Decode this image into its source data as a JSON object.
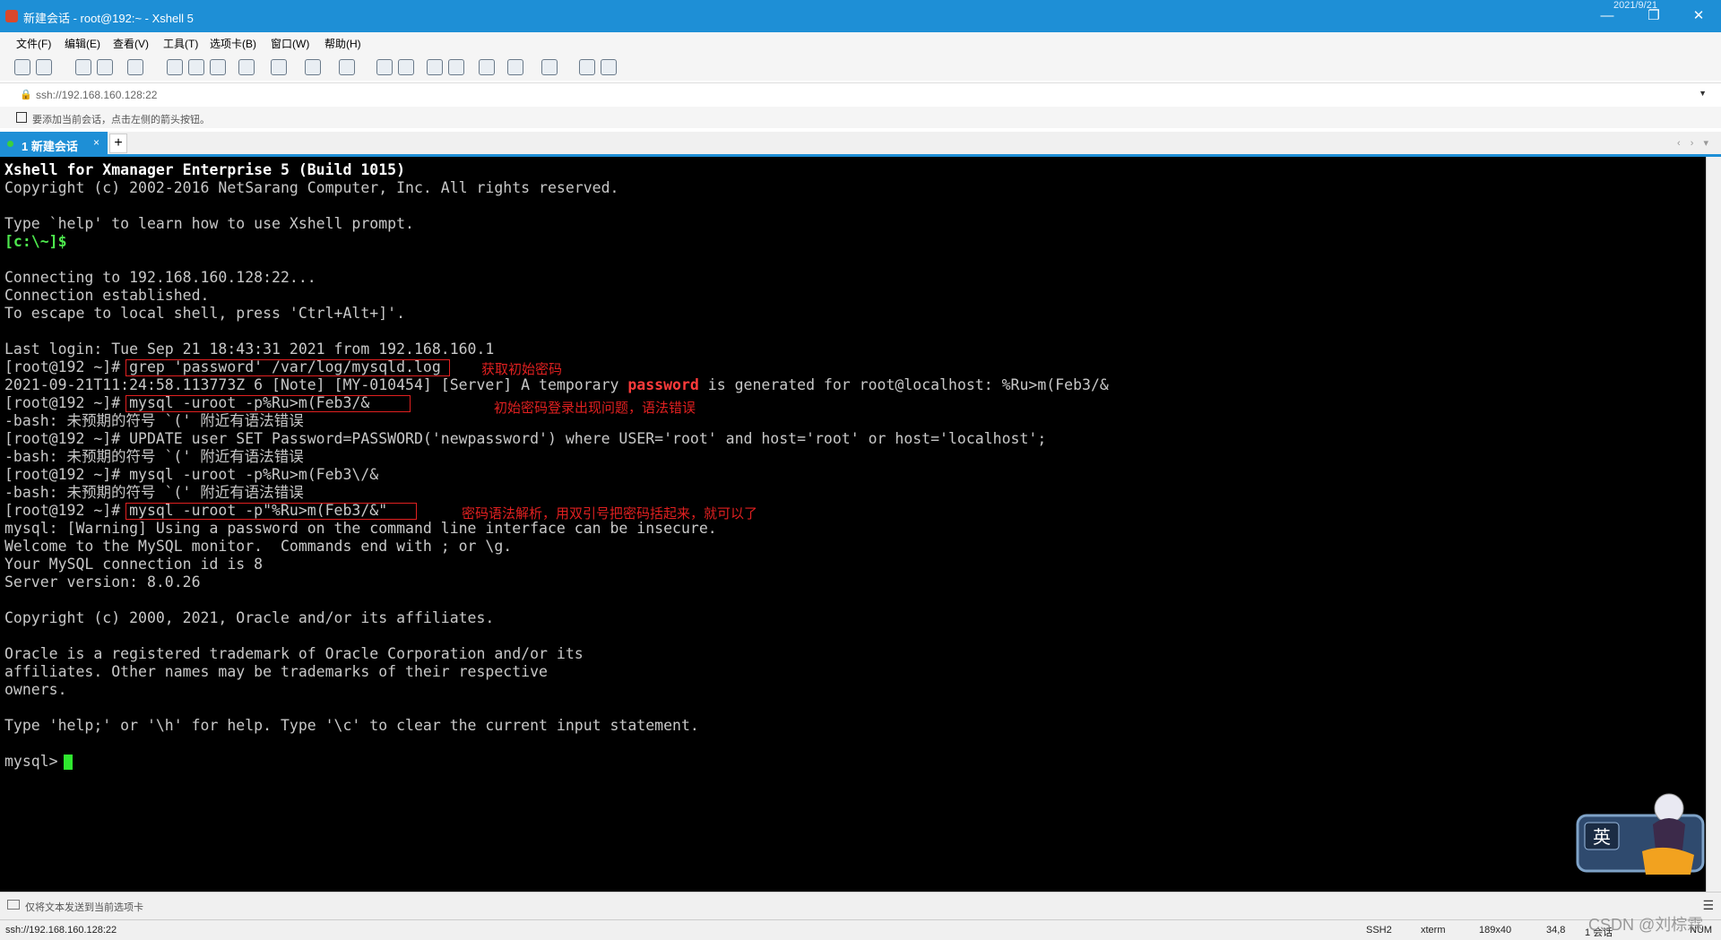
{
  "window": {
    "title": "新建会话 - root@192:~ - Xshell 5",
    "date_clip": "2021/9/21",
    "controls": {
      "minimize": "—",
      "restore": "❐",
      "close": "✕"
    }
  },
  "menu": [
    "文件(F)",
    "编辑(E)",
    "查看(V)",
    "工具(T)",
    "选项卡(B)",
    "窗口(W)",
    "帮助(H)"
  ],
  "address": {
    "url": "ssh://192.168.160.128:22"
  },
  "hint": {
    "text": "要添加当前会话，点击左侧的箭头按钮。"
  },
  "tabs": {
    "active_label": "1 新建会话",
    "close": "×",
    "add": "+",
    "nav": "‹ › ▾"
  },
  "terminal": {
    "lines": [
      "Xshell for Xmanager Enterprise 5 (Build 1015)",
      "Copyright (c) 2002-2016 NetSarang Computer, Inc. All rights reserved.",
      "",
      "Type `help' to learn how to use Xshell prompt.",
      "[c:\\~]$",
      "",
      "Connecting to 192.168.160.128:22...",
      "Connection established.",
      "To escape to local shell, press 'Ctrl+Alt+]'.",
      "",
      "Last login: Tue Sep 21 18:43:31 2021 from 192.168.160.1",
      "[root@192 ~]# grep 'password' /var/log/mysqld.log",
      "",
      "[root@192 ~]# mysql -uroot -p%Ru>m(Feb3/&",
      "-bash: 未预期的符号 `(' 附近有语法错误",
      "[root@192 ~]# UPDATE user SET Password=PASSWORD('newpassword') where USER='root' and host='root' or host='localhost';",
      "-bash: 未预期的符号 `(' 附近有语法错误",
      "[root@192 ~]# mysql -uroot -p%Ru>m(Feb3\\/&",
      "-bash: 未预期的符号 `(' 附近有语法错误",
      "[root@192 ~]# mysql -uroot -p\"%Ru>m(Feb3/&\"",
      "mysql: [Warning] Using a password on the command line interface can be insecure.",
      "Welcome to the MySQL monitor.  Commands end with ; or \\g.",
      "Your MySQL connection id is 8",
      "Server version: 8.0.26",
      "",
      "Copyright (c) 2000, 2021, Oracle and/or its affiliates.",
      "",
      "Oracle is a registered trademark of Oracle Corporation and/or its",
      "affiliates. Other names may be trademarks of their respective",
      "owners.",
      "",
      "Type 'help;' or '\\h' for help. Type '\\c' to clear the current input statement.",
      "",
      "mysql>"
    ],
    "log_line": {
      "before": "2021-09-21T11:24:58.113773Z 6 [Note] [MY-010454] [Server] A temporary ",
      "keyword": "password",
      "after": " is generated for root@localhost: %Ru>m(Feb3/&"
    },
    "annotations": [
      "获取初始密码",
      "初始密码登录出现问题，语法错误",
      "密码语法解析，用双引号把密码括起来，就可以了"
    ]
  },
  "send_bar": {
    "text": "仅将文本发送到当前选项卡"
  },
  "status": {
    "url": "ssh://192.168.160.128:22",
    "protocol": "SSH2",
    "term": "xterm",
    "size": "189x40",
    "cursor_pos": "34,8",
    "sessions": "1 会话",
    "num": "NUM"
  },
  "watermark": "CSDN @刘棕霖",
  "mascot": {
    "glyph": "英"
  }
}
